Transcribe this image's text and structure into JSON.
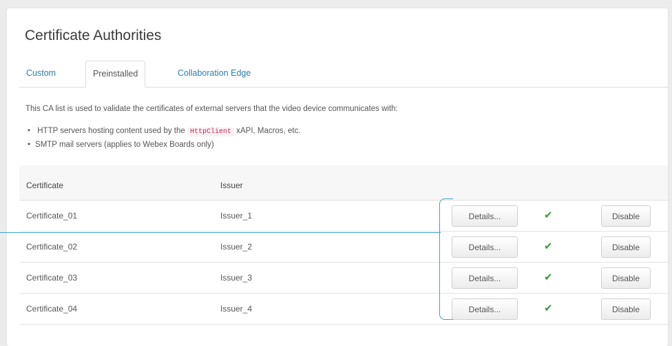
{
  "page": {
    "title": "Certificate Authorities"
  },
  "tabs": [
    {
      "label": "Custom",
      "active": false
    },
    {
      "label": "Preinstalled",
      "active": true
    },
    {
      "label": "Collaboration Edge",
      "active": false
    }
  ],
  "description": {
    "intro": "This CA list is used to validate the certificates of external servers that the video device communicates with:",
    "bullet1_before": "HTTP servers hosting content used by the",
    "bullet1_code": "HttpClient",
    "bullet1_after": "xAPI, Macros, etc.",
    "bullet2": "SMTP mail servers (applies to Webex Boards only)"
  },
  "table": {
    "headers": {
      "certificate": "Certificate",
      "issuer": "Issuer"
    },
    "rows": [
      {
        "certificate": "Certificate_01",
        "issuer": "Issuer_1",
        "details_label": "Details...",
        "enabled": true,
        "disable_label": "Disable"
      },
      {
        "certificate": "Certificate_02",
        "issuer": "Issuer_2",
        "details_label": "Details...",
        "enabled": true,
        "disable_label": "Disable"
      },
      {
        "certificate": "Certificate_03",
        "issuer": "Issuer_3",
        "details_label": "Details...",
        "enabled": true,
        "disable_label": "Disable"
      },
      {
        "certificate": "Certificate_04",
        "issuer": "Issuer_4",
        "details_label": "Details...",
        "enabled": true,
        "disable_label": "Disable"
      }
    ]
  },
  "colors": {
    "link": "#2a7fb0",
    "check": "#3c9a3c",
    "callout": "#3aa0c8",
    "code": "#c7254e"
  },
  "icons": {
    "enabled_status": "checkmark-icon"
  }
}
